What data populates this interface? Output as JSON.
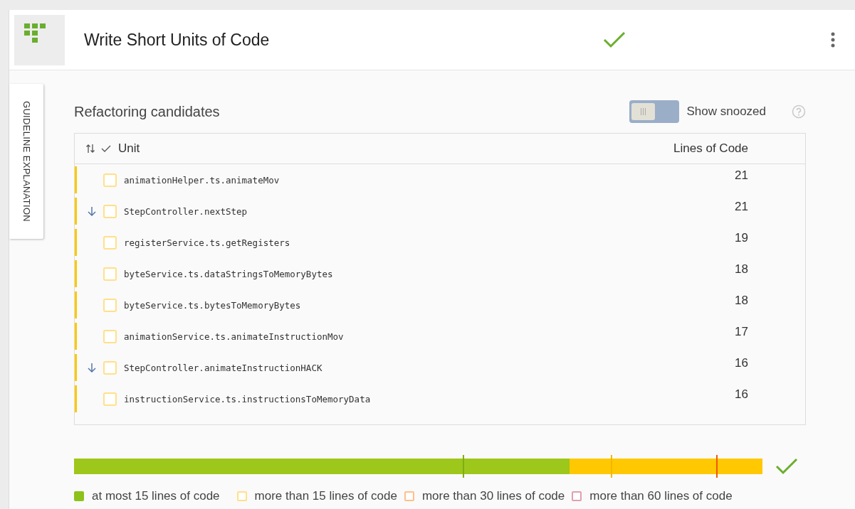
{
  "header": {
    "title": "Write Short Units of Code",
    "passed": true
  },
  "side_tab": {
    "label": "GUIDELINE EXPLANATION"
  },
  "candidates": {
    "title": "Refactoring candidates",
    "toggle": {
      "label": "Show snoozed",
      "on": false
    },
    "columns": [
      "Unit",
      "Lines of Code"
    ],
    "rows": [
      {
        "unit": "animationHelper.ts.animateMov",
        "loc": "21",
        "marked": false,
        "checked": false
      },
      {
        "unit": "StepController.nextStep",
        "loc": "21",
        "marked": true,
        "checked": false
      },
      {
        "unit": "registerService.ts.getRegisters",
        "loc": "19",
        "marked": false,
        "checked": false
      },
      {
        "unit": "byteService.ts.dataStringsToMemoryBytes",
        "loc": "18",
        "marked": false,
        "checked": false
      },
      {
        "unit": "byteService.ts.bytesToMemoryBytes",
        "loc": "18",
        "marked": false,
        "checked": false
      },
      {
        "unit": "animationService.ts.animateInstructionMov",
        "loc": "17",
        "marked": false,
        "checked": false
      },
      {
        "unit": "StepController.animateInstructionHACK",
        "loc": "16",
        "marked": true,
        "checked": false
      },
      {
        "unit": "instructionService.ts.instructionsToMemoryData",
        "loc": "16",
        "marked": false,
        "checked": false
      }
    ]
  },
  "risk_bar": {
    "passed": true,
    "level": 0.72,
    "thresholds": [
      {
        "level": 0.565,
        "color": "#7fae12"
      },
      {
        "level": 0.78,
        "color": "#f0b800"
      },
      {
        "level": 0.933,
        "color": "#f05a00"
      }
    ]
  },
  "legend": [
    {
      "label": "at most 15 lines of code",
      "color": "#8cc21a",
      "kind": "filled"
    },
    {
      "label": "more than 15 lines of code",
      "color": "#ffe08a",
      "kind": "outline"
    },
    {
      "label": "more than 30 lines of code",
      "color": "#ffc08a",
      "kind": "outline"
    },
    {
      "label": "more than 60 lines of code",
      "color": "#e0a0b0",
      "kind": "outline"
    }
  ]
}
